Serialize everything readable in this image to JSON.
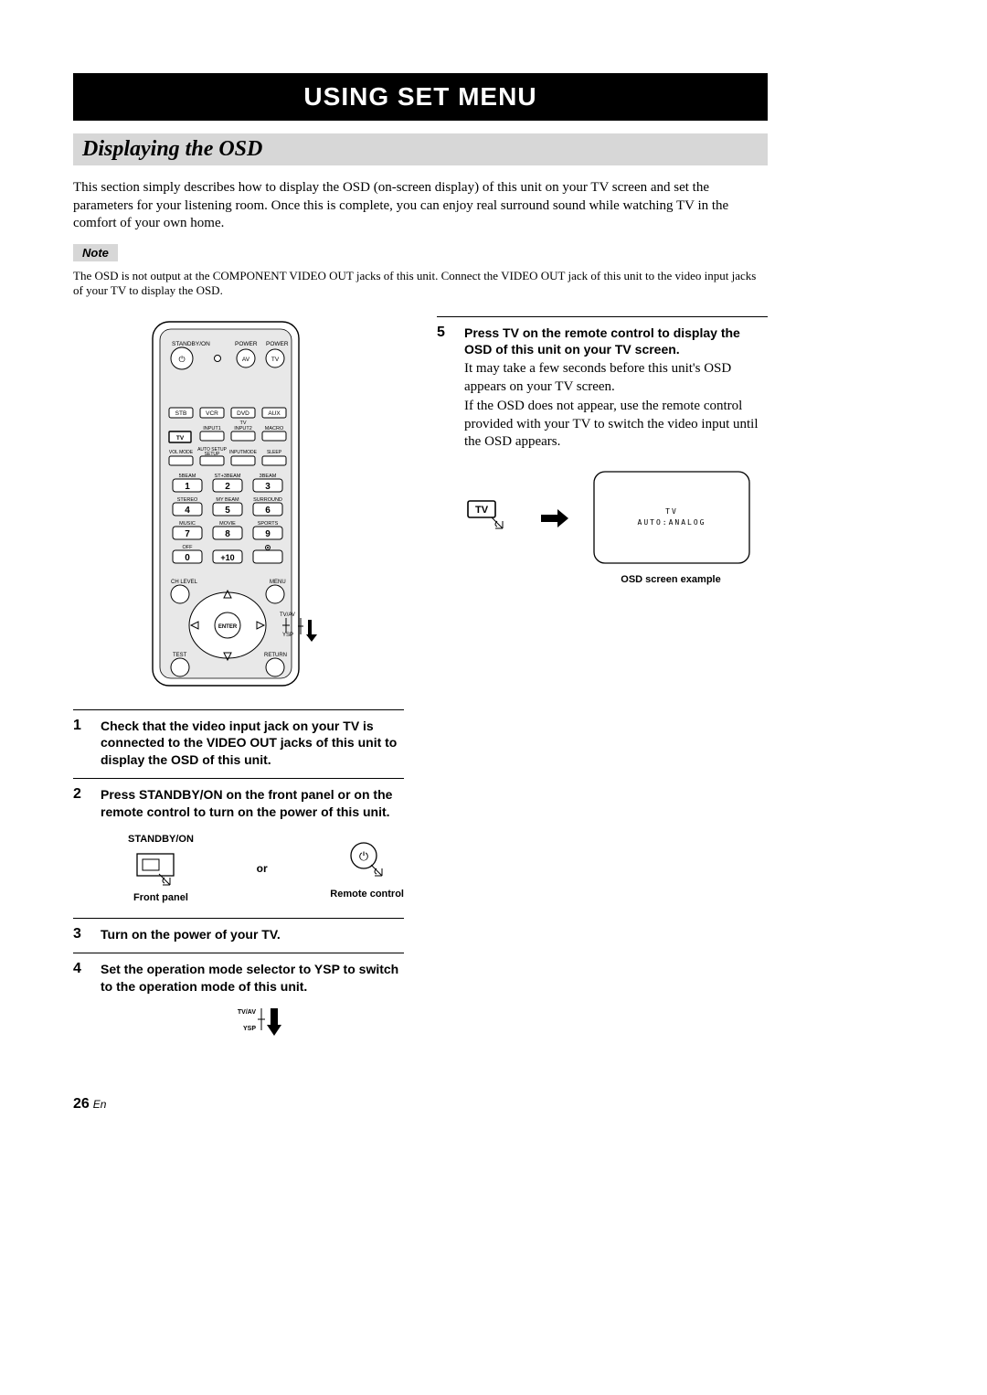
{
  "title": "USING SET MENU",
  "section": "Displaying the OSD",
  "intro": "This section simply describes how to display the OSD (on-screen display) of this unit on your TV screen and set the parameters for your listening room. Once this is complete, you can enjoy real surround sound while watching TV in the comfort of your own home.",
  "note_label": "Note",
  "note_text": "The OSD is not output at the COMPONENT VIDEO OUT jacks of this unit. Connect the VIDEO OUT jack of this unit to the video input jacks of your TV to display the OSD.",
  "remote": {
    "row_top": {
      "standby_on": "STANDBY/ON",
      "power1": "POWER",
      "power2": "POWER",
      "av": "AV",
      "tv": "TV"
    },
    "src_row": [
      "STB",
      "VCR",
      "DVD",
      "AUX"
    ],
    "src_row2_labels": [
      "",
      "INPUT1",
      "INPUT2",
      "MACRO"
    ],
    "src_row2_pre": "TV",
    "tv_label": "TV",
    "mode_labels": [
      "VOL MODE",
      "AUTO SETUP",
      "INPUTMODE",
      "SLEEP"
    ],
    "keypad": {
      "labels_r1": [
        "5BEAM",
        "ST+3BEAM",
        "3BEAM"
      ],
      "keys_r1": [
        "1",
        "2",
        "3"
      ],
      "labels_r2": [
        "STEREO",
        "MY BEAM",
        "SURROUND"
      ],
      "keys_r2": [
        "4",
        "5",
        "6"
      ],
      "labels_r3": [
        "MUSIC",
        "MOVIE",
        "SPORTS"
      ],
      "keys_r3": [
        "7",
        "8",
        "9"
      ],
      "labels_r4": [
        "OFF",
        "",
        ""
      ],
      "keys_r4": [
        "0",
        "+10",
        ""
      ]
    },
    "bottom": {
      "ch_level": "CH LEVEL",
      "menu": "MENU",
      "enter": "ENTER",
      "test": "TEST",
      "return": "RETURN",
      "tvav": "TV/AV",
      "ysp": "YSP"
    }
  },
  "steps_left": [
    {
      "n": "1",
      "title": "Check that the video input jack on your TV is connected to the VIDEO OUT jacks of this unit to display the OSD of this unit."
    },
    {
      "n": "2",
      "title": "Press STANDBY/ON on the front panel or on the remote control to turn on the power of this unit."
    },
    {
      "n": "3",
      "title": "Turn on the power of your TV."
    },
    {
      "n": "4",
      "title": "Set the operation mode selector to YSP to switch to the operation mode of this unit."
    }
  ],
  "panels": {
    "standby": "STANDBY/ON",
    "or": "or",
    "front": "Front panel",
    "remote": "Remote control"
  },
  "switch_labels": {
    "tvav": "TV/AV",
    "ysp": "YSP"
  },
  "step5": {
    "n": "5",
    "title": "Press TV on the remote control to display the OSD of this unit on your TV screen.",
    "body1": "It may take a few seconds before this unit's OSD appears on your TV screen.",
    "body2": "If the OSD does not appear, use the remote control provided with your TV to switch the video input until the OSD appears."
  },
  "tv_button": "TV",
  "osd": {
    "line1": "TV",
    "line2": "AUTO:ANALOG"
  },
  "osd_caption": "OSD screen example",
  "page": {
    "num": "26",
    "lang": "En"
  }
}
